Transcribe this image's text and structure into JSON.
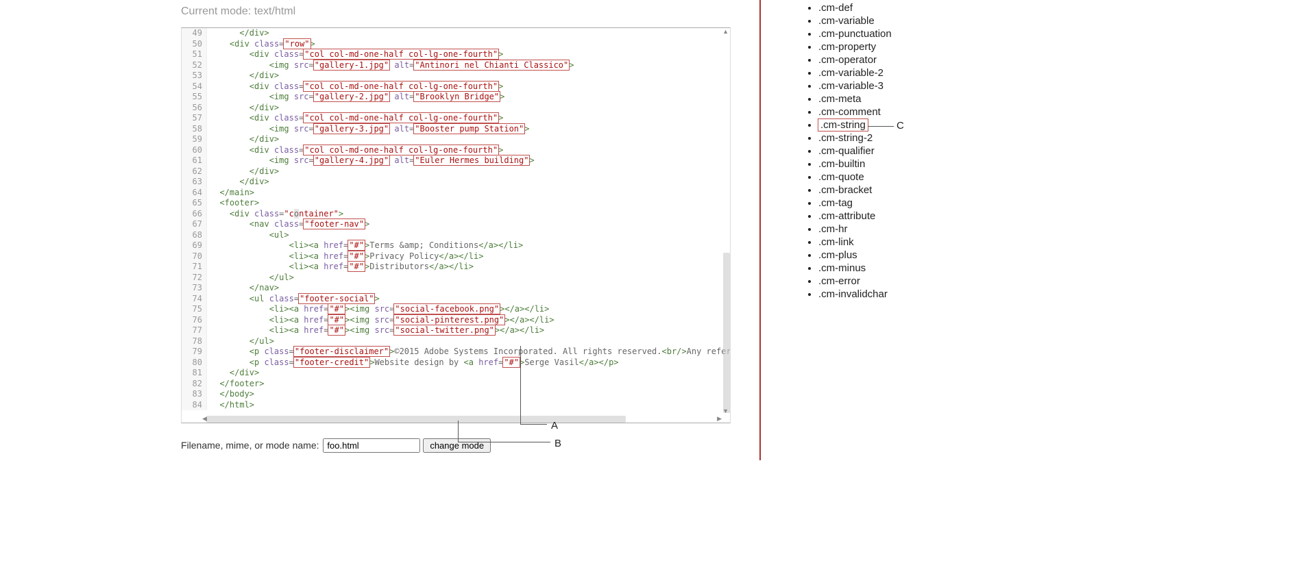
{
  "mode_line": "Current mode: text/html",
  "filename_label": "Filename, mime, or mode name:",
  "filename_value": "foo.html",
  "change_mode_label": "change mode",
  "callouts": {
    "a": "A",
    "b": "B",
    "c": "C"
  },
  "sidebar_items": [
    ".cm-def",
    ".cm-variable",
    ".cm-punctuation",
    ".cm-property",
    ".cm-operator",
    ".cm-variable-2",
    ".cm-variable-3",
    ".cm-meta",
    ".cm-comment",
    ".cm-string",
    ".cm-string-2",
    ".cm-qualifier",
    ".cm-builtin",
    ".cm-quote",
    ".cm-bracket",
    ".cm-tag",
    ".cm-attribute",
    ".cm-hr",
    ".cm-link",
    ".cm-plus",
    ".cm-minus",
    ".cm-error",
    ".cm-invalidchar"
  ],
  "sidebar_highlight_index": 9,
  "code_lines": [
    {
      "n": 49,
      "tokens": [
        [
          "plain",
          "      "
        ],
        [
          "tag",
          "</div>"
        ]
      ]
    },
    {
      "n": 50,
      "tokens": [
        [
          "plain",
          "    "
        ],
        [
          "tag",
          "<div"
        ],
        [
          "plain",
          " "
        ],
        [
          "attr",
          "class"
        ],
        [
          "plain",
          "="
        ],
        [
          "hl-str",
          "\"row\""
        ],
        [
          "tag",
          ">"
        ]
      ]
    },
    {
      "n": 51,
      "tokens": [
        [
          "plain",
          "        "
        ],
        [
          "tag",
          "<div"
        ],
        [
          "plain",
          " "
        ],
        [
          "attr",
          "class"
        ],
        [
          "plain",
          "="
        ],
        [
          "hl-str",
          "\"col col-md-one-half col-lg-one-fourth\""
        ],
        [
          "tag",
          ">"
        ]
      ]
    },
    {
      "n": 52,
      "tokens": [
        [
          "plain",
          "            "
        ],
        [
          "tag",
          "<img"
        ],
        [
          "plain",
          " "
        ],
        [
          "attr",
          "src"
        ],
        [
          "plain",
          "="
        ],
        [
          "hl-str",
          "\"gallery-1.jpg\""
        ],
        [
          "plain",
          " "
        ],
        [
          "attr",
          "alt"
        ],
        [
          "plain",
          "="
        ],
        [
          "hl-str",
          "\"Antinori nel Chianti Classico\""
        ],
        [
          "tag",
          ">"
        ]
      ]
    },
    {
      "n": 53,
      "tokens": [
        [
          "plain",
          "        "
        ],
        [
          "tag",
          "</div>"
        ]
      ]
    },
    {
      "n": 54,
      "tokens": [
        [
          "plain",
          "        "
        ],
        [
          "tag",
          "<div"
        ],
        [
          "plain",
          " "
        ],
        [
          "attr",
          "class"
        ],
        [
          "plain",
          "="
        ],
        [
          "hl-str",
          "\"col col-md-one-half col-lg-one-fourth\""
        ],
        [
          "tag",
          ">"
        ]
      ]
    },
    {
      "n": 55,
      "tokens": [
        [
          "plain",
          "            "
        ],
        [
          "tag",
          "<img"
        ],
        [
          "plain",
          " "
        ],
        [
          "attr",
          "src"
        ],
        [
          "plain",
          "="
        ],
        [
          "hl-str",
          "\"gallery-2.jpg\""
        ],
        [
          "plain",
          " "
        ],
        [
          "attr",
          "alt"
        ],
        [
          "plain",
          "="
        ],
        [
          "hl-str",
          "\"Brooklyn Bridge\""
        ],
        [
          "tag",
          ">"
        ]
      ]
    },
    {
      "n": 56,
      "tokens": [
        [
          "plain",
          "        "
        ],
        [
          "tag",
          "</div>"
        ]
      ]
    },
    {
      "n": 57,
      "tokens": [
        [
          "plain",
          "        "
        ],
        [
          "tag",
          "<div"
        ],
        [
          "plain",
          " "
        ],
        [
          "attr",
          "class"
        ],
        [
          "plain",
          "="
        ],
        [
          "hl-str",
          "\"col col-md-one-half col-lg-one-fourth\""
        ],
        [
          "tag",
          ">"
        ]
      ]
    },
    {
      "n": 58,
      "tokens": [
        [
          "plain",
          "            "
        ],
        [
          "tag",
          "<img"
        ],
        [
          "plain",
          " "
        ],
        [
          "attr",
          "src"
        ],
        [
          "plain",
          "="
        ],
        [
          "hl-str",
          "\"gallery-3.jpg\""
        ],
        [
          "plain",
          " "
        ],
        [
          "attr",
          "alt"
        ],
        [
          "plain",
          "="
        ],
        [
          "hl-str",
          "\"Booster pump Station\""
        ],
        [
          "tag",
          ">"
        ]
      ]
    },
    {
      "n": 59,
      "tokens": [
        [
          "plain",
          "        "
        ],
        [
          "tag",
          "</div>"
        ]
      ]
    },
    {
      "n": 60,
      "tokens": [
        [
          "plain",
          "        "
        ],
        [
          "tag",
          "<div"
        ],
        [
          "plain",
          " "
        ],
        [
          "attr",
          "class"
        ],
        [
          "plain",
          "="
        ],
        [
          "hl-str",
          "\"col col-md-one-half col-lg-one-fourth\""
        ],
        [
          "tag",
          ">"
        ]
      ]
    },
    {
      "n": 61,
      "tokens": [
        [
          "plain",
          "            "
        ],
        [
          "tag",
          "<img"
        ],
        [
          "plain",
          " "
        ],
        [
          "attr",
          "src"
        ],
        [
          "plain",
          "="
        ],
        [
          "hl-str",
          "\"gallery-4.jpg\""
        ],
        [
          "plain",
          " "
        ],
        [
          "attr",
          "alt"
        ],
        [
          "plain",
          "="
        ],
        [
          "hl-str",
          "\"Euler Hermes building\""
        ],
        [
          "tag",
          ">"
        ]
      ]
    },
    {
      "n": 62,
      "tokens": [
        [
          "plain",
          "        "
        ],
        [
          "tag",
          "</div>"
        ]
      ]
    },
    {
      "n": 63,
      "tokens": [
        [
          "plain",
          "      "
        ],
        [
          "tag",
          "</div>"
        ]
      ]
    },
    {
      "n": 64,
      "tokens": [
        [
          "plain",
          "  "
        ],
        [
          "tag",
          "</main>"
        ]
      ]
    },
    {
      "n": 65,
      "tokens": [
        [
          "plain",
          "  "
        ],
        [
          "tag",
          "<footer>"
        ]
      ]
    },
    {
      "n": 66,
      "tokens": [
        [
          "plain",
          "    "
        ],
        [
          "tag",
          "<div"
        ],
        [
          "plain",
          " "
        ],
        [
          "attr",
          "class"
        ],
        [
          "plain",
          "="
        ],
        [
          "str",
          "\"c"
        ],
        [
          "ghost",
          "o"
        ],
        [
          "str",
          "ntainer\""
        ],
        [
          "tag",
          ">"
        ]
      ]
    },
    {
      "n": 67,
      "tokens": [
        [
          "plain",
          "        "
        ],
        [
          "tag",
          "<nav"
        ],
        [
          "plain",
          " "
        ],
        [
          "attr",
          "class"
        ],
        [
          "plain",
          "="
        ],
        [
          "hl-str",
          "\"footer-nav\""
        ],
        [
          "tag",
          ">"
        ]
      ]
    },
    {
      "n": 68,
      "tokens": [
        [
          "plain",
          "            "
        ],
        [
          "tag",
          "<ul>"
        ]
      ]
    },
    {
      "n": 69,
      "tokens": [
        [
          "plain",
          "                "
        ],
        [
          "tag",
          "<li><a"
        ],
        [
          "plain",
          " "
        ],
        [
          "attr",
          "href"
        ],
        [
          "plain",
          "="
        ],
        [
          "hl-str",
          "\"#\""
        ],
        [
          "tag",
          ">"
        ],
        [
          "plain",
          "Terms &amp; Conditions"
        ],
        [
          "tag",
          "</a></li>"
        ]
      ]
    },
    {
      "n": 70,
      "tokens": [
        [
          "plain",
          "                "
        ],
        [
          "tag",
          "<li><a"
        ],
        [
          "plain",
          " "
        ],
        [
          "attr",
          "href"
        ],
        [
          "plain",
          "="
        ],
        [
          "hl-str",
          "\"#\""
        ],
        [
          "tag",
          ">"
        ],
        [
          "plain",
          "Privacy Policy"
        ],
        [
          "tag",
          "</a></li>"
        ]
      ]
    },
    {
      "n": 71,
      "tokens": [
        [
          "plain",
          "                "
        ],
        [
          "tag",
          "<li><a"
        ],
        [
          "plain",
          " "
        ],
        [
          "attr",
          "href"
        ],
        [
          "plain",
          "="
        ],
        [
          "hl-str",
          "\"#\""
        ],
        [
          "tag",
          ">"
        ],
        [
          "plain",
          "Distributors"
        ],
        [
          "tag",
          "</a></li>"
        ]
      ]
    },
    {
      "n": 72,
      "tokens": [
        [
          "plain",
          "            "
        ],
        [
          "tag",
          "</ul>"
        ]
      ]
    },
    {
      "n": 73,
      "tokens": [
        [
          "plain",
          "        "
        ],
        [
          "tag",
          "</nav>"
        ]
      ]
    },
    {
      "n": 74,
      "tokens": [
        [
          "plain",
          "        "
        ],
        [
          "tag",
          "<ul"
        ],
        [
          "plain",
          " "
        ],
        [
          "attr",
          "class"
        ],
        [
          "plain",
          "="
        ],
        [
          "hl-str",
          "\"footer-social\""
        ],
        [
          "tag",
          ">"
        ]
      ]
    },
    {
      "n": 75,
      "tokens": [
        [
          "plain",
          "            "
        ],
        [
          "tag",
          "<li><a"
        ],
        [
          "plain",
          " "
        ],
        [
          "attr",
          "href"
        ],
        [
          "plain",
          "="
        ],
        [
          "hl-str",
          "\"#\""
        ],
        [
          "tag",
          "><img"
        ],
        [
          "plain",
          " "
        ],
        [
          "attr",
          "src"
        ],
        [
          "plain",
          "="
        ],
        [
          "hl-str",
          "\"social-facebook.png\""
        ],
        [
          "tag",
          "></a></li>"
        ]
      ]
    },
    {
      "n": 76,
      "tokens": [
        [
          "plain",
          "            "
        ],
        [
          "tag",
          "<li><a"
        ],
        [
          "plain",
          " "
        ],
        [
          "attr",
          "href"
        ],
        [
          "plain",
          "="
        ],
        [
          "hl-str",
          "\"#\""
        ],
        [
          "tag",
          "><img"
        ],
        [
          "plain",
          " "
        ],
        [
          "attr",
          "src"
        ],
        [
          "plain",
          "="
        ],
        [
          "hl-str",
          "\"social-pinterest.png\""
        ],
        [
          "tag",
          "></a></li>"
        ]
      ]
    },
    {
      "n": 77,
      "tokens": [
        [
          "plain",
          "            "
        ],
        [
          "tag",
          "<li><a"
        ],
        [
          "plain",
          " "
        ],
        [
          "attr",
          "href"
        ],
        [
          "plain",
          "="
        ],
        [
          "hl-str",
          "\"#\""
        ],
        [
          "tag",
          "><img"
        ],
        [
          "plain",
          " "
        ],
        [
          "attr",
          "src"
        ],
        [
          "plain",
          "="
        ],
        [
          "hl-str",
          "\"social-twitter.png\""
        ],
        [
          "tag",
          "></a></li>"
        ]
      ]
    },
    {
      "n": 78,
      "tokens": [
        [
          "plain",
          "        "
        ],
        [
          "tag",
          "</ul>"
        ]
      ]
    },
    {
      "n": 79,
      "tokens": [
        [
          "plain",
          "        "
        ],
        [
          "tag",
          "<p"
        ],
        [
          "plain",
          " "
        ],
        [
          "attr",
          "class"
        ],
        [
          "plain",
          "="
        ],
        [
          "hl-str",
          "\"footer-disclaimer\""
        ],
        [
          "tag",
          ">"
        ],
        [
          "plain",
          "©2015 Adobe Systems Incorporated. All rights reserved."
        ],
        [
          "tag",
          "<br/>"
        ],
        [
          "plain",
          "Any reference is not intended to re"
        ]
      ]
    },
    {
      "n": 80,
      "tokens": [
        [
          "plain",
          "        "
        ],
        [
          "tag",
          "<p"
        ],
        [
          "plain",
          " "
        ],
        [
          "attr",
          "class"
        ],
        [
          "plain",
          "="
        ],
        [
          "hl-str",
          "\"footer-credit\""
        ],
        [
          "tag",
          ">"
        ],
        [
          "plain",
          "Website design by "
        ],
        [
          "tag",
          "<a"
        ],
        [
          "plain",
          " "
        ],
        [
          "attr",
          "href"
        ],
        [
          "plain",
          "="
        ],
        [
          "hl-str",
          "\"#\""
        ],
        [
          "tag",
          ">"
        ],
        [
          "plain",
          "Serge Vasil"
        ],
        [
          "tag",
          "</a></p>"
        ]
      ]
    },
    {
      "n": 81,
      "tokens": [
        [
          "plain",
          "    "
        ],
        [
          "tag",
          "</div>"
        ]
      ]
    },
    {
      "n": 82,
      "tokens": [
        [
          "plain",
          "  "
        ],
        [
          "tag",
          "</footer>"
        ]
      ]
    },
    {
      "n": 83,
      "tokens": [
        [
          "plain",
          "  "
        ],
        [
          "tag",
          "</body>"
        ]
      ]
    },
    {
      "n": 84,
      "tokens": [
        [
          "plain",
          "  "
        ],
        [
          "tag",
          "</html>"
        ]
      ]
    }
  ]
}
